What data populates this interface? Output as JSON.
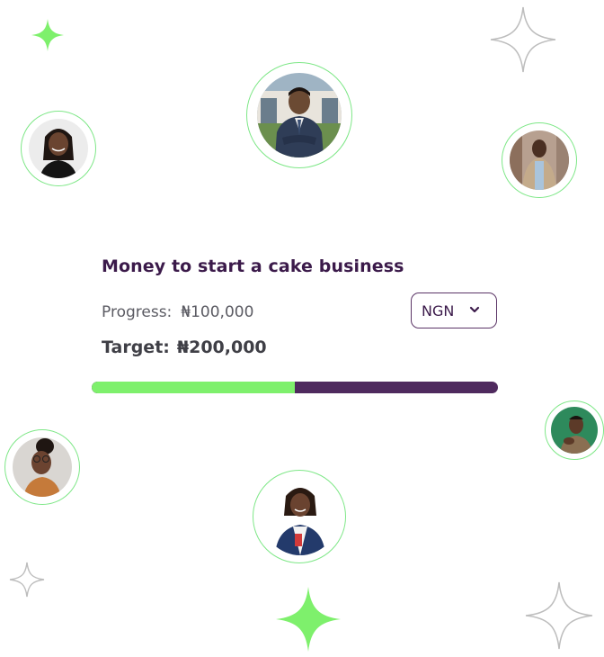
{
  "goal": {
    "title": "Money to start a cake business",
    "progress_label": "Progress:",
    "progress_amount": "₦100,000",
    "target_label": "Target:",
    "target_amount": "₦200,000",
    "progress_fraction": 0.5
  },
  "currency_select": {
    "selected": "NGN",
    "icon": "chevron-down-icon"
  },
  "colors": {
    "accent_green": "#7ef06c",
    "brand_purple": "#4f2a5e",
    "title_purple": "#3b1a4a",
    "avatar_ring": "#7ee787",
    "sparkle_gray": "#bdbdbd"
  }
}
